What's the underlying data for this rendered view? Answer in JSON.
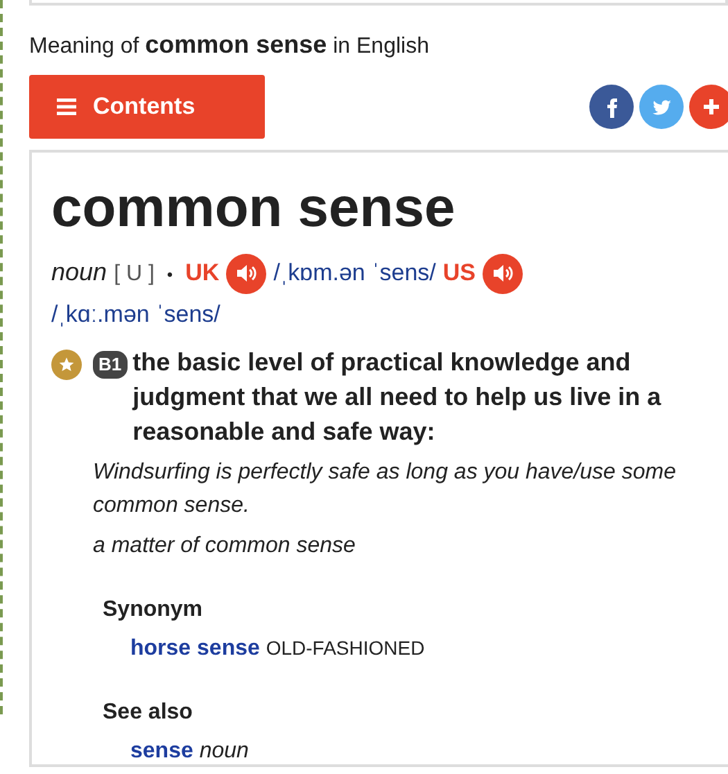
{
  "header": {
    "text": "Meaning of **common sense** in English"
  },
  "contents_button": {
    "label": "Contents"
  },
  "share_buttons": [
    {
      "kind": "facebook"
    },
    {
      "kind": "twitter"
    },
    {
      "kind": "more"
    }
  ],
  "entry": {
    "headword": "common sense",
    "pos": "noun",
    "grammar": "[ U ]",
    "separator": "•",
    "pronunciations": [
      {
        "region": "UK",
        "ipa": "/ˌkɒm.ən ˈsens/"
      },
      {
        "region": "US",
        "ipa": "/ˌkɑː.mən ˈsens/"
      }
    ]
  },
  "sense": {
    "level": "B1",
    "definition": "the basic level of practical knowledge and judgment that we all need to help us live in a reasonable and safe way:",
    "examples": [
      "Windsurfing is perfectly safe as long as you have/use some common sense.",
      "a matter of common sense"
    ]
  },
  "synonym": {
    "heading": "Synonym",
    "word": "horse sense",
    "label": "OLD-FASHIONED"
  },
  "see_also": {
    "heading": "See also",
    "word": "sense",
    "pos": "noun"
  }
}
